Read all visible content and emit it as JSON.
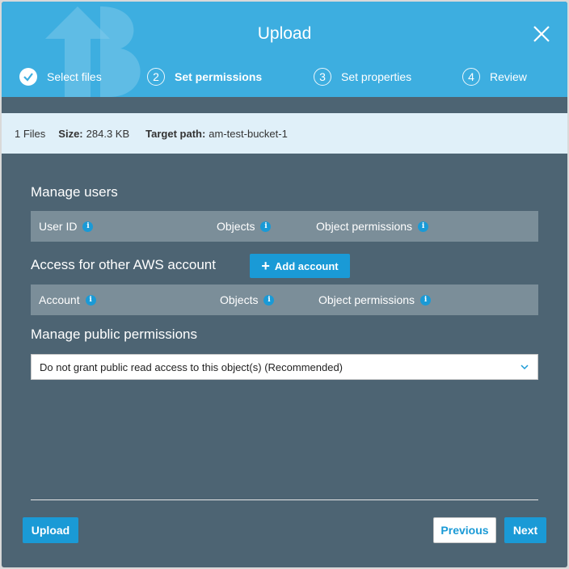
{
  "modal": {
    "title": "Upload",
    "close_icon": "close-icon"
  },
  "steps": [
    {
      "number": "1",
      "label": "Select files",
      "status": "done"
    },
    {
      "number": "2",
      "label": "Set permissions",
      "status": "active"
    },
    {
      "number": "3",
      "label": "Set properties",
      "status": "pending"
    },
    {
      "number": "4",
      "label": "Review",
      "status": "pending"
    }
  ],
  "info_bar": {
    "files": "1 Files",
    "size_label": "Size:",
    "size_value": "284.3 KB",
    "target_label": "Target path:",
    "target_value": "am-test-bucket-1"
  },
  "manage_users": {
    "title": "Manage users",
    "columns": [
      "User ID",
      "Objects",
      "Object permissions"
    ]
  },
  "other_accounts": {
    "title": "Access for other AWS account",
    "add_button": "Add account",
    "columns": [
      "Account",
      "Objects",
      "Object permissions"
    ]
  },
  "public_permissions": {
    "title": "Manage public permissions",
    "selected": "Do not grant public read access to this object(s) (Recommended)"
  },
  "footer": {
    "upload": "Upload",
    "previous": "Previous",
    "next": "Next"
  },
  "colors": {
    "header": "#3daee0",
    "body": "#4d6473",
    "info_bar": "#e0f0f9",
    "table_header": "#7b8e99",
    "accent": "#1a9ad6"
  }
}
